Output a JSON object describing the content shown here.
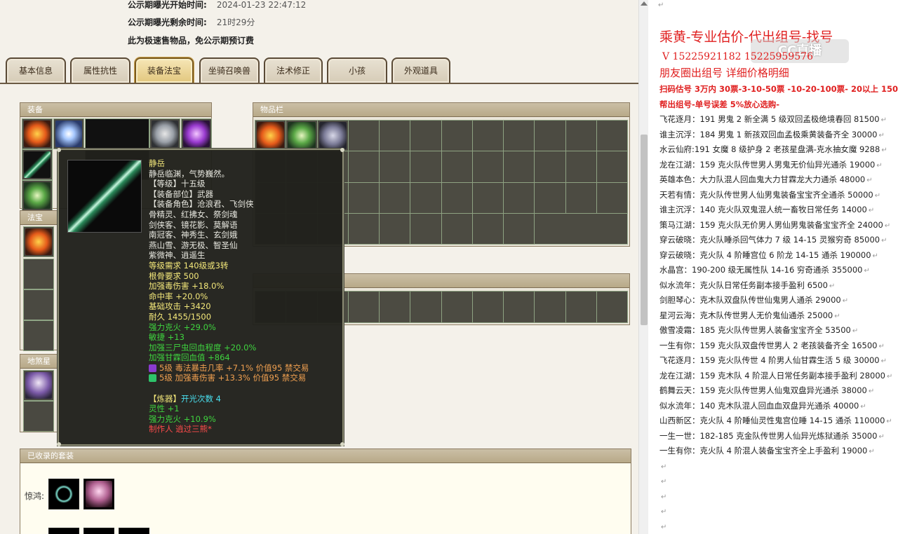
{
  "notice": {
    "start_label": "公示期曝光开始时间:",
    "start_value": "2024-01-23 22:47:12",
    "remain_label": "公示期曝光剩余时间:",
    "remain_value": "21时29分",
    "fast_sale": "此为极速售物品，免公示期预订费"
  },
  "tabs": [
    "基本信息",
    "属性抗性",
    "装备法宝",
    "坐骑召唤兽",
    "法术修正",
    "小孩",
    "外观道具"
  ],
  "active_tab": "装备法宝",
  "panels": {
    "equipment": "装备",
    "inventory": "物品栏",
    "fabao": "法宝",
    "dishaxing": "地煞星",
    "sets": "已收录的套装",
    "set_label": "惊鸿:"
  },
  "tooltip": {
    "name": "静岳",
    "desc": "静岳临渊，气势巍然。",
    "level": "【等级】十五级",
    "part": "【装备部位】武器",
    "roles": [
      "【装备角色】沧浪君、飞剑侠",
      "骨精灵、红拂女、祭剑魂",
      "剑侠客、镜花影、莫解语",
      "南冠客、神秀生、玄剑娥",
      "燕山雪、游无极、智圣仙",
      "紫微神、逍遥生"
    ],
    "req_level": "等级需求 140级或3转",
    "req_root": "根骨要求 500",
    "stats_white": [
      "加强毒伤害 +18.0%",
      "命中率 +20.0%",
      "基础攻击 +3420",
      "耐久 1455/1500"
    ],
    "stats_green": [
      "强力克火 +29.0%",
      "敏捷 +13",
      "加强三尸虫回血程度 +20.0%",
      "加强甘霖回血值 +864"
    ],
    "gems": [
      "5级 毒法暴击几率 +7.1% 价值95 禁交易",
      "5级 加强毒伤害 +13.3% 价值95 禁交易"
    ],
    "forge_label": "【炼器】",
    "forge_value": "开光次数 4",
    "forge_stats": [
      "灵性 +1",
      "强力克火 +10.9%"
    ],
    "maker": "制作人 逍过三熊*"
  },
  "document": {
    "title": "乘黄-专业估价-代出组号-找号",
    "phone": "V 15225921182    15225959576",
    "subtitle": "朋友圈出组号    详细价格明细",
    "pricing": "扫码估号 3万内 30票-3-10-50票 -10-20-100票- 20以上 150",
    "guarantee": "帮出组号-单号误差 5%放心选购-",
    "watermark": "CC直播",
    "listings": [
      "飞花逐月：191 男鬼 2 新全满 5 级双回孟极绝境春回 81500",
      "谁主沉浮：184 男鬼 1 新孩双回血孟极乘黄装备齐全 30000",
      "水云仙府:191 女魔 8 级护身 2 老孩星盘满-克水抽女魔 9288",
      "龙在江湖：159 克火队传世男人男鬼无价仙异光通杀 19000",
      "英雄本色：大力队混人回血鬼大力甘霖龙大力通杀 48000",
      "天若有情：克火队传世男人仙男鬼装备宝宝齐全通杀 50000",
      "谁主沉浮：140 克火队双鬼混人统一畜牧日常任务 14000",
      "策马江湖：159 克火队无价男人男仙男鬼装备宝宝齐全 24000",
      "穿云破晓：克火队睡杀回气体力 7 级 14-15 灵猴穷奇 85000",
      "穿云破晓：克火队 4 阶睡宫位 6 阶龙 14-15 通杀 190000",
      "水晶宫：190-200 级无属性队 14-16 穷奇通杀 355000",
      "似水流年：克火队日常任务副本接手盈利 6500",
      "剑胆琴心：克木队双盘队传世仙鬼男人通杀 29000",
      "星河云海：克木队传世男人无价鬼仙通杀 25000",
      "傲雪凌霜：185 克火队传世男人装备宝宝齐全 53500",
      "一生有你：159 克火队双盘传世男人 2 老孩装备齐全 16500",
      "飞花逐月：159 克火队传世 4 阶男人仙甘霖生活 5 级 30000",
      "龙在江湖：159 克木队 4 阶混人日常任务副本接手盈利 28000",
      "鹤舞云天：159 克火队传世男人仙鬼双盘异光通杀 38000",
      "似水流年：140 克木队混人回血血双盘异光通杀 40000",
      "山西新区：克火队 4 阶睡仙灵性鬼宫位睡 14-15 通杀 110000",
      "一生一世：182-185 克金队传世男人仙异光炼狱通杀 35000",
      "一生有你：克火队 4 阶混人装备宝宝齐全上手盈利 19000"
    ]
  }
}
